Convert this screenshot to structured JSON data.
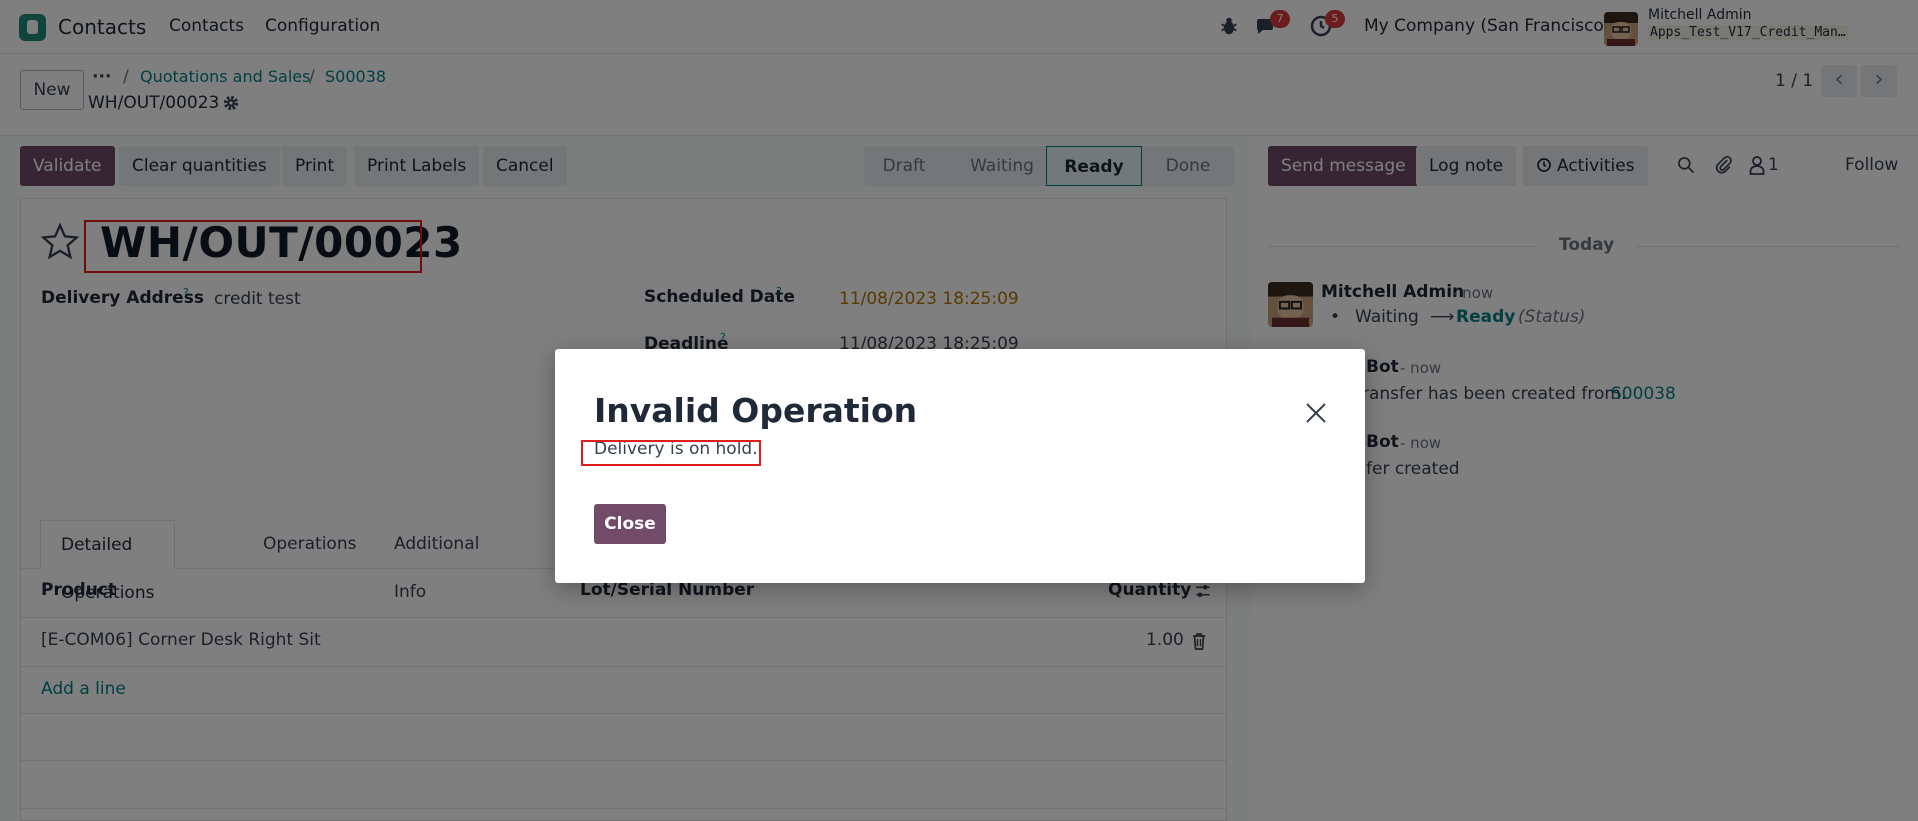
{
  "navbar": {
    "app_name": "Contacts",
    "menu": [
      "Contacts",
      "Configuration"
    ],
    "messages_badge": "7",
    "activities_badge": "5",
    "company": "My Company (San Francisco)",
    "user_name": "Mitchell Admin",
    "database": "Apps_Test_V17_Credit_Man…"
  },
  "control": {
    "new_label": "New",
    "breadcrumb_dots": "···",
    "breadcrumb": [
      "Quotations and Sales",
      "S00038"
    ],
    "record_name": "WH/OUT/00023",
    "pager": "1 / 1"
  },
  "actions": {
    "validate": "Validate",
    "clear_quantities": "Clear quantities",
    "print": "Print",
    "print_labels": "Print Labels",
    "cancel": "Cancel"
  },
  "status": {
    "stages": [
      "Draft",
      "Waiting",
      "Ready",
      "Done"
    ],
    "current": "Ready"
  },
  "form": {
    "title": "WH/OUT/00023",
    "delivery_address_label": "Delivery Address",
    "delivery_address": "credit test",
    "scheduled_date_label": "Scheduled Date",
    "scheduled_date": "11/08/2023 18:25:09",
    "deadline_label": "Deadline",
    "deadline": "11/08/2023 18:25:09",
    "help_mark": "?"
  },
  "tabs": [
    "Detailed Operations",
    "Operations",
    "Additional Info"
  ],
  "table": {
    "headers": [
      "Product",
      "Lot/Serial Number",
      "Quantity"
    ],
    "rows": [
      {
        "product": "[E-COM06] Corner Desk Right Sit",
        "quantity": "1.00"
      }
    ],
    "add_line": "Add a line"
  },
  "chatter": {
    "send_message": "Send message",
    "log_note": "Log note",
    "activities": "Activities",
    "followers_count": "1",
    "follow": "Follow",
    "date_separator": "Today",
    "messages": [
      {
        "author": "Mitchell Admin",
        "time": "- now",
        "from": "Waiting",
        "to": "Ready",
        "field": "(Status)"
      },
      {
        "author": "Bot",
        "time": "- now",
        "text": "ransfer has been created from:",
        "link": "S00038"
      },
      {
        "author": "Bot",
        "time": "- now",
        "text": "fer created"
      }
    ]
  },
  "modal": {
    "title": "Invalid Operation",
    "body": "Delivery is on hold.",
    "close_button": "Close"
  },
  "colors": {
    "primary": "#714b67",
    "link": "#017e84",
    "highlight_box": "#e11d1d"
  }
}
